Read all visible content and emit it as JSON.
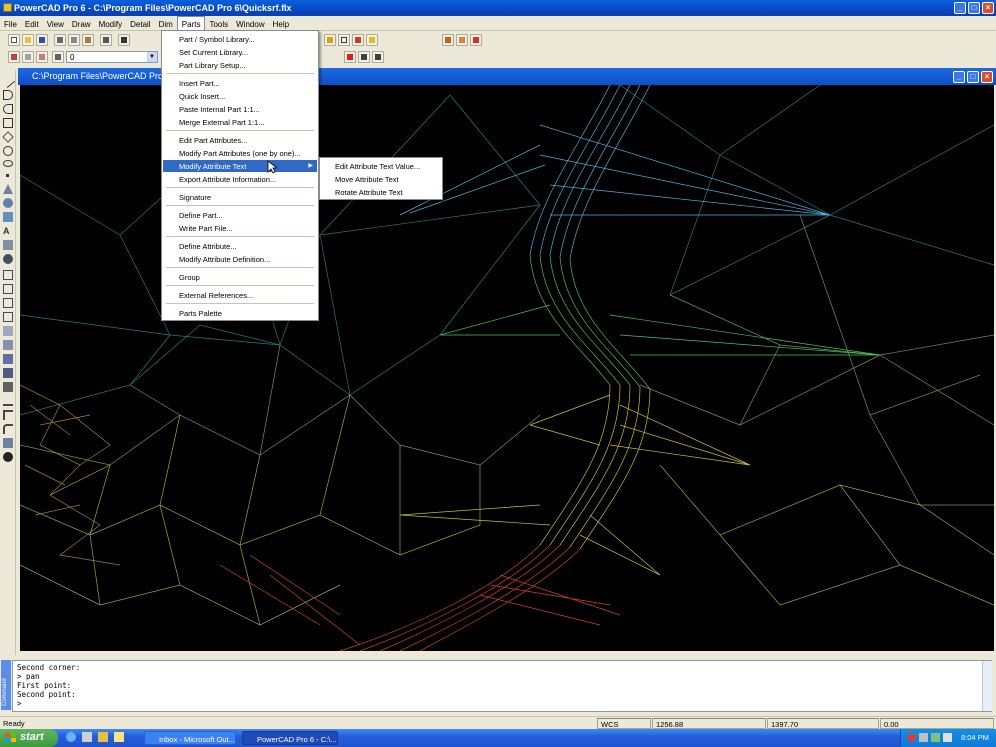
{
  "window": {
    "title": "PowerCAD Pro 6 - C:\\Program Files\\PowerCAD Pro 6\\Quicksrf.flx",
    "controls": [
      "_",
      "□",
      "×"
    ]
  },
  "menubar": {
    "items": [
      "File",
      "Edit",
      "View",
      "Draw",
      "Modify",
      "Detail",
      "Dim",
      "Parts",
      "Tools",
      "Window",
      "Help"
    ],
    "active": "Parts"
  },
  "toolbar": {
    "layer_value": "0"
  },
  "parts_menu": {
    "items": [
      {
        "label": "Part / Symbol Library..."
      },
      {
        "label": "Set Current Library..."
      },
      {
        "label": "Part Library Setup..."
      },
      {
        "label": "Insert Part..."
      },
      {
        "label": "Quick Insert..."
      },
      {
        "label": "Paste Internal Part 1:1..."
      },
      {
        "label": "Merge External Part 1:1..."
      },
      {
        "label": "Edit Part Attributes..."
      },
      {
        "label": "Modify Part Attributes (one by one)..."
      },
      {
        "label": "Modify Attribute Text"
      },
      {
        "label": "Export Attribute Information..."
      },
      {
        "label": "Signature"
      },
      {
        "label": "Define Part..."
      },
      {
        "label": "Write Part File..."
      },
      {
        "label": "Define Attribute..."
      },
      {
        "label": "Modify Attribute Definition..."
      },
      {
        "label": "Group"
      },
      {
        "label": "External References..."
      },
      {
        "label": "Parts Palette"
      }
    ],
    "highlighted": "Modify Attribute Text"
  },
  "submenu": {
    "items": [
      "Edit Attribute Text Value...",
      "Move Attribute Text",
      "Rotate Attribute Text"
    ]
  },
  "document": {
    "title": "C:\\Program Files\\PowerCAD Pro 6"
  },
  "command": {
    "tab_label": "Command",
    "lines": [
      "Second corner:",
      "> pan",
      "First point:",
      "Second point:",
      ">"
    ]
  },
  "statusbar": {
    "status": "Ready",
    "coord_system": "WCS",
    "x": "1256.88",
    "y": "1397.70",
    "z": "0.00"
  },
  "taskbar": {
    "start_label": "start",
    "tasks": [
      "Inbox - Microsoft Out...",
      "PowerCAD Pro 6 - C:\\..."
    ],
    "clock": "8:04 PM"
  },
  "colors": {
    "menu_highlight": "#316ac5",
    "titlebar": "#0a5fdc",
    "canvas_background": "#000000"
  }
}
